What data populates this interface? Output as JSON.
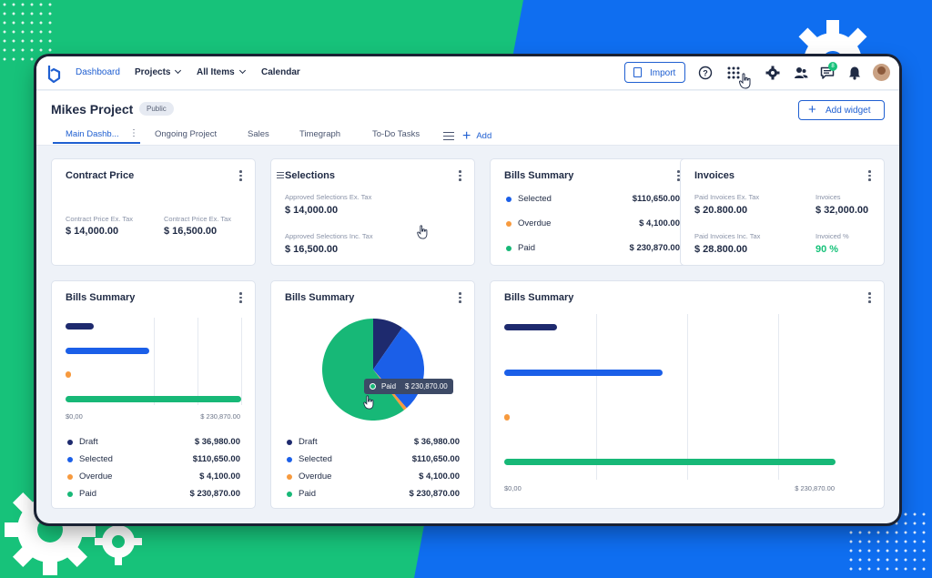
{
  "colors": {
    "brand": "#1f5fd1",
    "draft": "#1e2a6e",
    "selected": "#1b5fe8",
    "overdue": "#f79a3e",
    "paid": "#17b877",
    "positive": "#17c27a"
  },
  "topbar": {
    "nav": [
      {
        "label": "Dashboard",
        "active": true
      },
      {
        "label": "Projects"
      },
      {
        "label": "All Items"
      },
      {
        "label": "Calendar"
      }
    ],
    "import_label": "Import",
    "icons": [
      "help-icon",
      "apps-grid-icon",
      "settings-gear-icon",
      "users-icon",
      "messages-icon",
      "bell-icon",
      "user-avatar"
    ],
    "messages_badge": "8"
  },
  "header": {
    "project_title": "Mikes Project",
    "visibility_badge": "Public",
    "add_widget_label": "Add widget",
    "tabs": [
      "Main Dashb...",
      "Ongoing Project",
      "Sales",
      "Timegraph",
      "To-Do Tasks"
    ],
    "add_tab_label": "Add"
  },
  "contract_price": {
    "title": "Contract Price",
    "ex_tax_label": "Contract Price Ex. Tax",
    "ex_tax_value": "$ 14,000.00",
    "inc_tax_label": "Contract Price Ex. Tax",
    "inc_tax_value": "$ 16,500.00"
  },
  "selections": {
    "title": "Selections",
    "ex_tax_label": "Approved Selections Ex. Tax",
    "ex_tax_value": "$ 14,000.00",
    "inc_tax_label": "Approved Selections Inc. Tax",
    "inc_tax_value": "$ 16,500.00"
  },
  "bills_summary_small": {
    "title": "Bills Summary",
    "rows": [
      {
        "label": "Selected",
        "value": "$110,650.00"
      },
      {
        "label": "Overdue",
        "value": "$ 4,100.00"
      },
      {
        "label": "Paid",
        "value": "$ 230,870.00"
      }
    ]
  },
  "invoices": {
    "title": "Invoices",
    "paid_ex_tax_label": "Paid Invoices Ex. Tax",
    "paid_ex_tax_value": "$ 20.800.00",
    "invoices_label": "Invoices",
    "invoices_value": "$ 32,000.00",
    "paid_inc_tax_label": "Paid Invoices Inc. Tax",
    "paid_inc_tax_value": "$ 28.800.00",
    "invoiced_pct_label": "Invoiced %",
    "invoiced_pct_value": "90 %"
  },
  "bills_bar_card": {
    "title": "Bills Summary",
    "axis_min": "$0,00",
    "axis_max": "$ 230,870.00",
    "legend": [
      {
        "label": "Draft",
        "value": "$ 36,980.00"
      },
      {
        "label": "Selected",
        "value": "$110,650.00"
      },
      {
        "label": "Overdue",
        "value": "$ 4,100.00"
      },
      {
        "label": "Paid",
        "value": "$ 230,870.00"
      }
    ]
  },
  "bills_pie_card": {
    "title": "Bills Summary",
    "tooltip_label": "Paid",
    "tooltip_value": "$ 230,870.00",
    "legend": [
      {
        "label": "Draft",
        "value": "$ 36,980.00"
      },
      {
        "label": "Selected",
        "value": "$110,650.00"
      },
      {
        "label": "Overdue",
        "value": "$ 4,100.00"
      },
      {
        "label": "Paid",
        "value": "$ 230,870.00"
      }
    ]
  },
  "bills_wide_card": {
    "title": "Bills Summary",
    "axis_min": "$0,00",
    "axis_max": "$ 230,870.00"
  },
  "chart_data": [
    {
      "type": "bar",
      "orientation": "horizontal",
      "title": "Bills Summary",
      "categories": [
        "Draft",
        "Selected",
        "Overdue",
        "Paid"
      ],
      "values": [
        36980,
        110650,
        4100,
        230870
      ],
      "xlim": [
        0,
        230870
      ]
    },
    {
      "type": "pie",
      "title": "Bills Summary",
      "categories": [
        "Draft",
        "Selected",
        "Overdue",
        "Paid"
      ],
      "values": [
        36980,
        110650,
        4100,
        230870
      ]
    },
    {
      "type": "bar",
      "orientation": "horizontal",
      "title": "Bills Summary",
      "categories": [
        "Draft",
        "Selected",
        "Overdue",
        "Paid"
      ],
      "values": [
        36980,
        110650,
        4100,
        230870
      ],
      "xlim": [
        0,
        230870
      ]
    }
  ]
}
